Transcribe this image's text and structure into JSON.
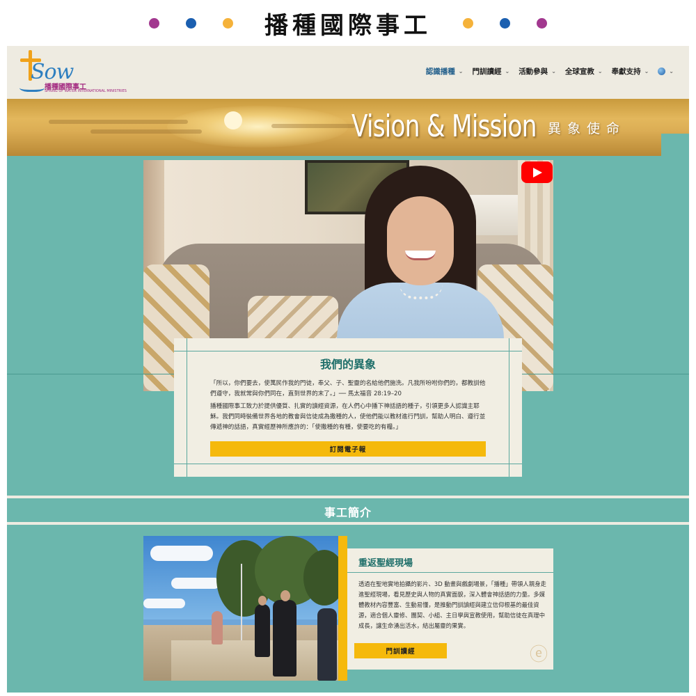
{
  "page_title": "播種國際事工",
  "dots": {
    "left": [
      "#a2388f",
      "#1b5fb0",
      "#f5b23a"
    ],
    "right": [
      "#f5b23a",
      "#1b5fb0",
      "#a2388f"
    ]
  },
  "logo": {
    "text": "Sow",
    "cn": "播種國際事工",
    "en": "SPRING OF WATER INTERNATIONAL MINISTRIES"
  },
  "nav": {
    "items": [
      {
        "label": "認識播種",
        "active": true
      },
      {
        "label": "門訓讀經",
        "active": false
      },
      {
        "label": "活動參與",
        "active": false
      },
      {
        "label": "全球宣教",
        "active": false
      },
      {
        "label": "奉獻支持",
        "active": false
      }
    ],
    "language_icon": "globe-icon"
  },
  "hero": {
    "title": "Vision & Mission",
    "subtitle": "異象使命"
  },
  "video": {
    "play_icon": "youtube-play-icon"
  },
  "vision": {
    "title": "我們的異象",
    "quote": "「所以，你們要去，使萬民作我的門徒，奉父、子、聖靈的名給他們施洗。凡我所吩咐你們的，都教訓他們遵守，我就常與你們同在，直到世界的末了。」── 馬太福音 28:19–20",
    "text": "播種國際事工致力於提供優質、扎實的讀經資源，在人們心中播下神話語的種子，引領更多人認識主耶穌。我們同時裝備世界各地的教會與信徒成為撒種的人，使他們能以教材進行門訓，幫助人明白、遵行並傳遞神的話語，真實經歷神所應許的：「使撒種的有種，使要吃的有糧。」",
    "button": "訂閱電子報"
  },
  "section": {
    "title": "事工簡介"
  },
  "ministry": {
    "title": "重返聖經現場",
    "text": "透過在聖地實地拍攝的影片、3D 動畫與戲劇場景，「播種」帶領人親身走進聖經現場，看見歷史與人物的真實面貌，深入體會神話語的力量。多媒體教材內容豐富、生動易懂，是推動門訓讀經與建立信仰根基的最佳資源，適合個人靈修、團契、小組、主日學與宣教使用，幫助信徒在真理中成長，讓生命湧出活水，結出屬靈的果實。",
    "button": "門訓讀經"
  },
  "colors": {
    "teal": "#6bb7ad",
    "cream": "#f1eee3",
    "gold": "#f5b90c",
    "heading_teal": "#1f6f6a"
  }
}
